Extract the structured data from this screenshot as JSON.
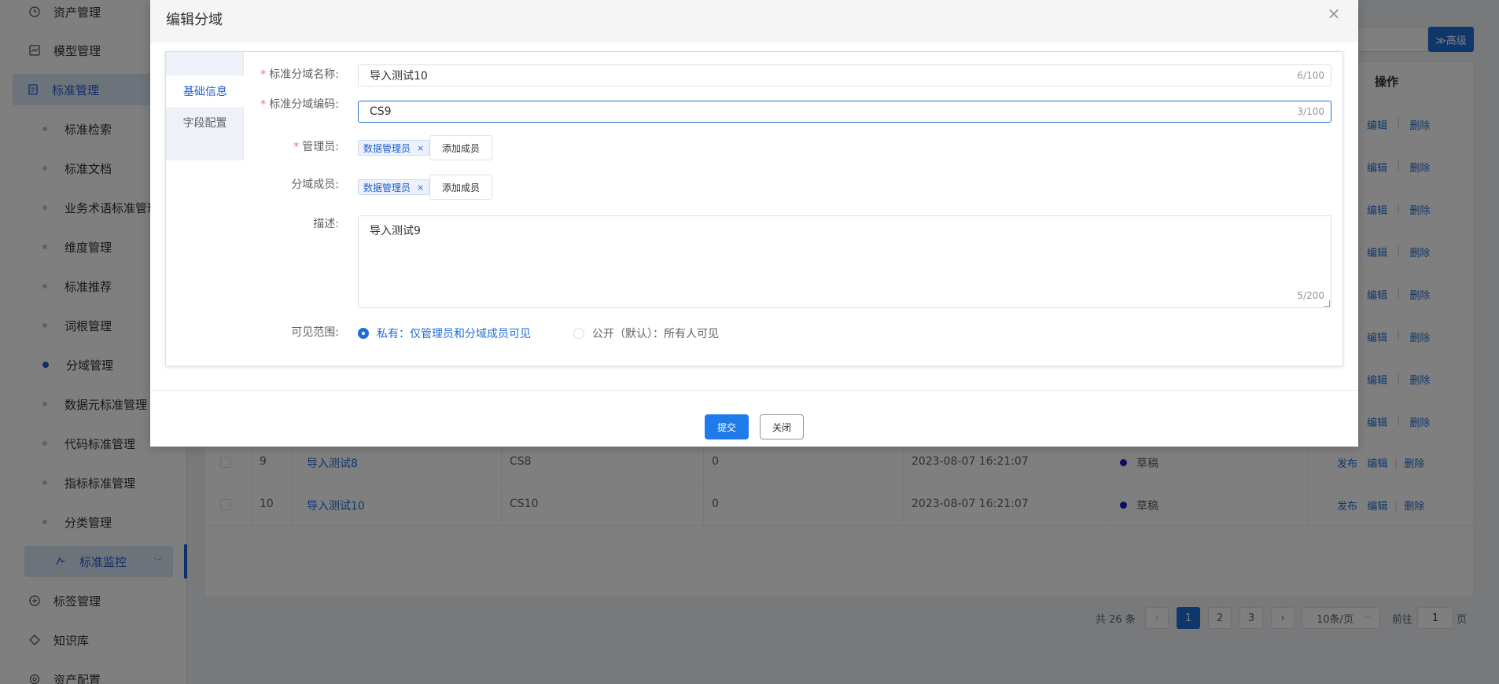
{
  "sidebar": {
    "items": [
      {
        "label": "资产管理",
        "icon": "clock-icon"
      },
      {
        "label": "模型管理",
        "icon": "chart-icon"
      },
      {
        "label": "标准管理",
        "icon": "document-icon"
      },
      {
        "label": "标准检索"
      },
      {
        "label": "标准文档"
      },
      {
        "label": "业务术语标准管理"
      },
      {
        "label": "维度管理"
      },
      {
        "label": "标准推荐"
      },
      {
        "label": "词根管理"
      },
      {
        "label": "分域管理"
      },
      {
        "label": "数据元标准管理"
      },
      {
        "label": "代码标准管理"
      },
      {
        "label": "指标标准管理"
      },
      {
        "label": "分类管理"
      },
      {
        "label": "标准监控",
        "icon": "monitor-icon"
      },
      {
        "label": "标签管理",
        "icon": "plus-circle-icon"
      },
      {
        "label": "知识库",
        "icon": "tag-icon"
      },
      {
        "label": "资产配置",
        "icon": "gear-icon"
      }
    ]
  },
  "toolbar": {
    "advanced_label": "≫高级"
  },
  "table": {
    "op_header": "操作",
    "row_ops": {
      "publish": "发布",
      "edit": "编辑",
      "delete": "删除"
    },
    "rows": [
      {
        "index": "9",
        "name": "导入测试8",
        "code": "CS8",
        "count": "0",
        "time": "2023-08-07 16:21:07",
        "status": "草稿"
      },
      {
        "index": "10",
        "name": "导入测试10",
        "code": "CS10",
        "count": "0",
        "time": "2023-08-07 16:21:07",
        "status": "草稿"
      }
    ]
  },
  "pager": {
    "total": "共 26 条",
    "prev": "‹",
    "next": "›",
    "pages": [
      "1",
      "2",
      "3"
    ],
    "size": "10条/页",
    "goto_label": "前往",
    "goto_value": "1",
    "page_suffix": "页"
  },
  "dialog": {
    "title": "编辑分域",
    "close": "×",
    "tabs": [
      "基础信息",
      "字段配置"
    ],
    "form": {
      "name_label": "标准分域名称:",
      "name_value": "导入测试10",
      "name_count": "6/100",
      "code_label": "标准分域编码:",
      "code_value": "CS9",
      "code_count": "3/100",
      "admin_label": "管理员:",
      "admin_tag": "数据管理员",
      "member_label": "分域成员:",
      "member_tag": "数据管理员",
      "tag_remove": "×",
      "add_member": "添加成员",
      "desc_label": "描述:",
      "desc_value": "导入测试9",
      "desc_count": "5/200",
      "scope_label": "可见范围:",
      "scope_private": "私有：仅管理员和分域成员可见",
      "scope_public": "公开（默认）：所有人可见"
    },
    "submit": "提交",
    "cancel": "关闭"
  }
}
